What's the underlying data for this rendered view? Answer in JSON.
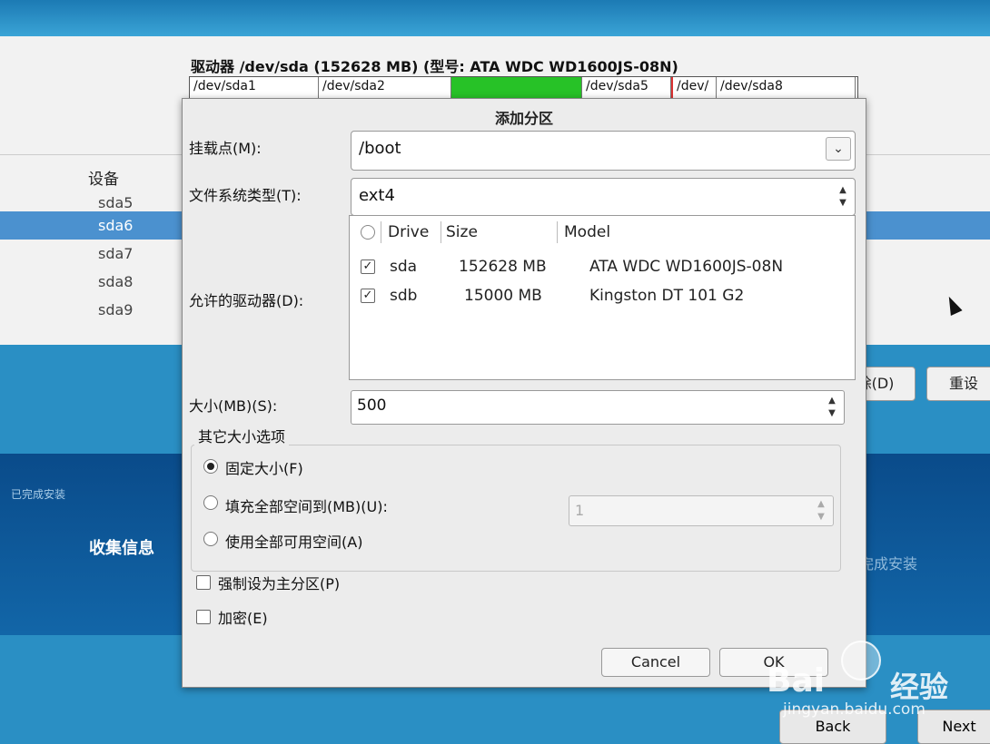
{
  "drive_header": {
    "title": "驱动器 /dev/sda (152628 MB) (型号: ATA WDC WD1600JS-08N)"
  },
  "partitions": [
    "/dev/sda1",
    "/dev/sda2",
    "",
    "/dev/sda5",
    "/dev/",
    "/dev/sda8"
  ],
  "device_list": {
    "header": "设备",
    "rows": [
      "sda5",
      "sda6",
      "sda7",
      "sda8",
      "sda9"
    ]
  },
  "background_buttons": {
    "delete_partial": "除(D)",
    "reset": "重设"
  },
  "sidebar": {
    "done_label": "已完成安装",
    "collect_label": "收集信息",
    "right_done": "完成安装"
  },
  "nav": {
    "back": "Back",
    "next": "Next"
  },
  "dialog": {
    "title": "添加分区",
    "mount_label": "挂载点(M):",
    "mount_value": "/boot",
    "fstype_label": "文件系统类型(T):",
    "fstype_value": "ext4",
    "drives_label": "允许的驱动器(D):",
    "drive_table": {
      "headers": [
        "Drive",
        "Size",
        "Model"
      ],
      "rows": [
        {
          "drive": "sda",
          "size": "152628 MB",
          "model": "ATA WDC WD1600JS-08N",
          "checked": true
        },
        {
          "drive": "sdb",
          "size": "15000 MB",
          "model": "Kingston DT 101 G2",
          "checked": true
        }
      ]
    },
    "size_label": "大小(MB)(S):",
    "size_value": "500",
    "other_size_title": "其它大小选项",
    "radio_fixed": "固定大小(F)",
    "radio_fill_to": "填充全部空间到(MB)(U):",
    "fill_to_value": "1",
    "radio_fill_all": "使用全部可用空间(A)",
    "force_primary": "强制设为主分区(P)",
    "encrypt": "加密(E)",
    "cancel": "Cancel",
    "ok": "OK"
  },
  "watermark": {
    "brand": "Bai",
    "brand2": "经验",
    "url": "jingyan.baidu.com"
  }
}
